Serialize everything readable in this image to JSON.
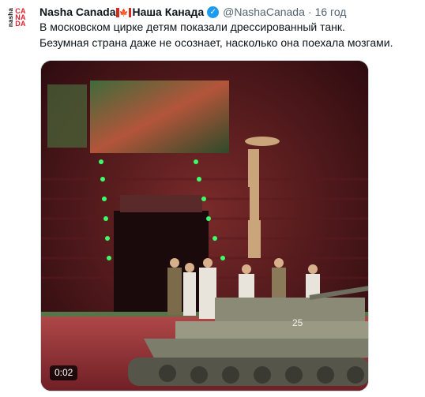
{
  "author": {
    "avatar_side_text": "nasha",
    "avatar_brand_lines": [
      "CA",
      "NA",
      "DA"
    ],
    "name_latin": "Nasha Canada",
    "name_cyrillic": "Наша Канада",
    "flag_glyph": "🍁",
    "verified_icon": "verified-badge-icon",
    "handle": "@NashaCanada",
    "separator": "·",
    "time": "16 год"
  },
  "tweet": {
    "text_line1": "В московском цирке детям показали дрессированный танк.",
    "text_line2": "Безумная страна даже не осознает, насколько она поехала мозгами."
  },
  "media": {
    "duration": "0:02",
    "tank_number": "25"
  },
  "colors": {
    "accent": "#1d9bf0",
    "brand_red": "#e0202e",
    "muted": "#536471"
  }
}
